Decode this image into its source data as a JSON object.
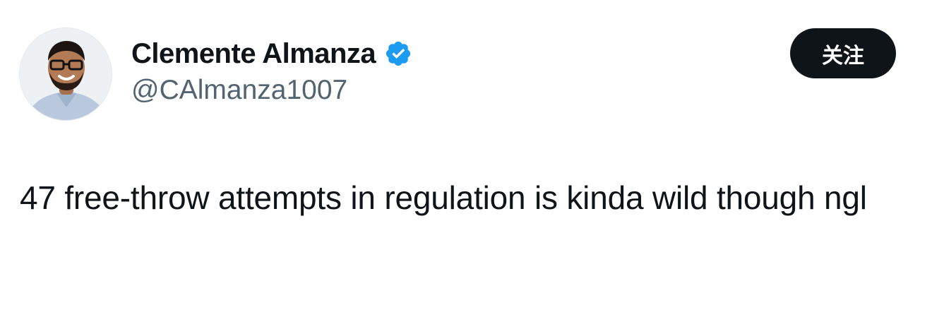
{
  "author": {
    "display_name": "Clemente Almanza",
    "handle": "@CAlmanza1007",
    "verified": true,
    "avatar_icon": "profile-photo"
  },
  "actions": {
    "follow_label": "关注"
  },
  "tweet": {
    "text": "47 free-throw attempts in regulation is kinda wild though ngl"
  },
  "colors": {
    "text_primary": "#0f1419",
    "text_secondary": "#536471",
    "verified_blue": "#1d9bf0",
    "follow_bg": "#0f1419",
    "follow_text": "#ffffff"
  }
}
